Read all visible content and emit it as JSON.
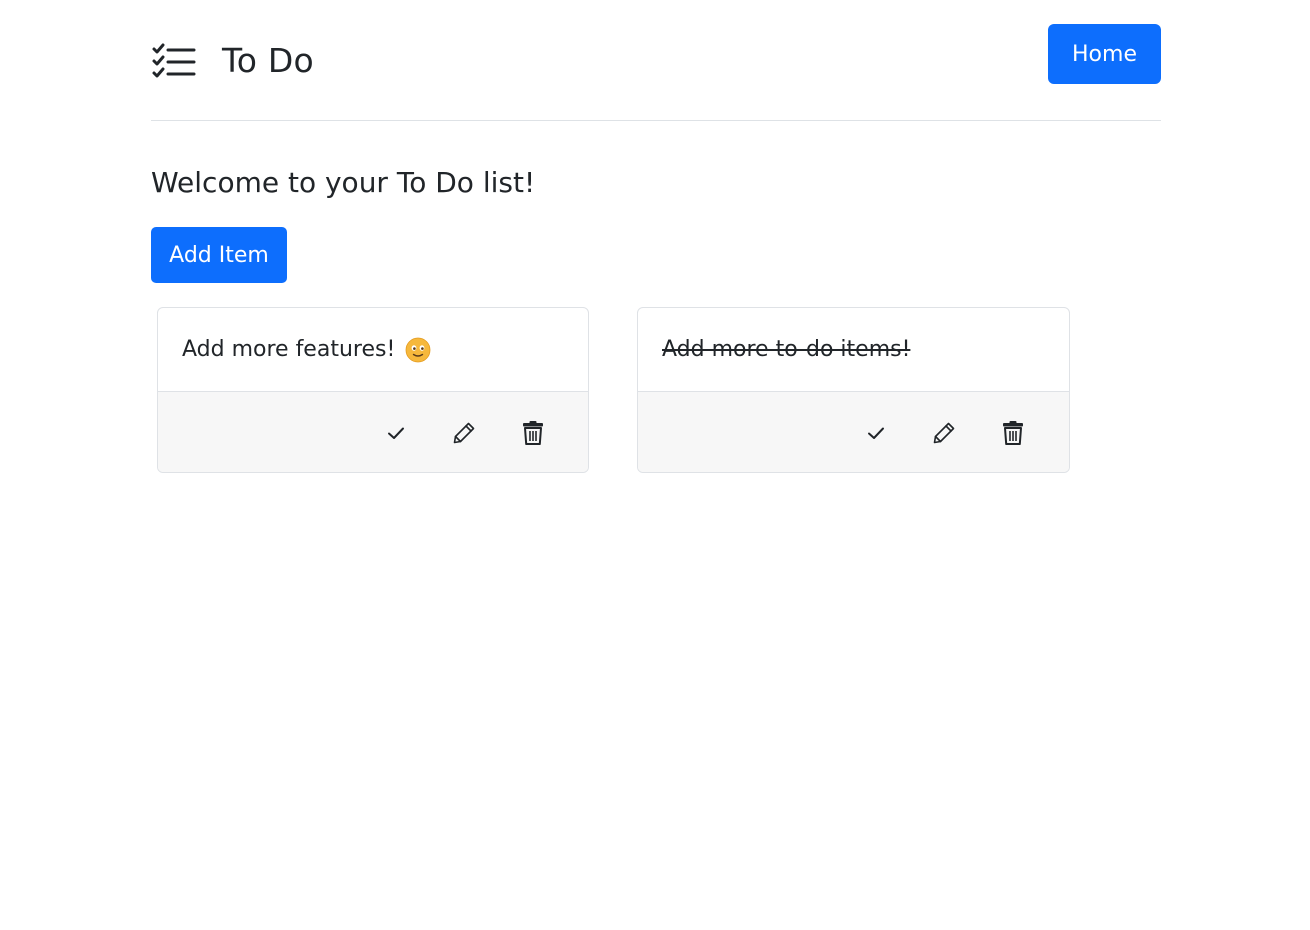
{
  "app": {
    "title": "To Do",
    "brand_icon": "checklist-icon"
  },
  "nav": {
    "home_label": "Home"
  },
  "main": {
    "welcome": "Welcome to your To Do list!",
    "add_item_label": "Add Item"
  },
  "items": [
    {
      "text": "Add more features!",
      "emoji_icon": "smiling-face-icon",
      "completed": false
    },
    {
      "text": "Add more to-do items!",
      "completed": true
    }
  ],
  "actions": [
    {
      "icon": "check-icon"
    },
    {
      "icon": "pencil-icon"
    },
    {
      "icon": "trash-icon"
    }
  ],
  "colors": {
    "primary": "#0d6efd",
    "text": "#212529",
    "footer_bg": "#f7f7f7",
    "border": "#dfe2e6"
  }
}
